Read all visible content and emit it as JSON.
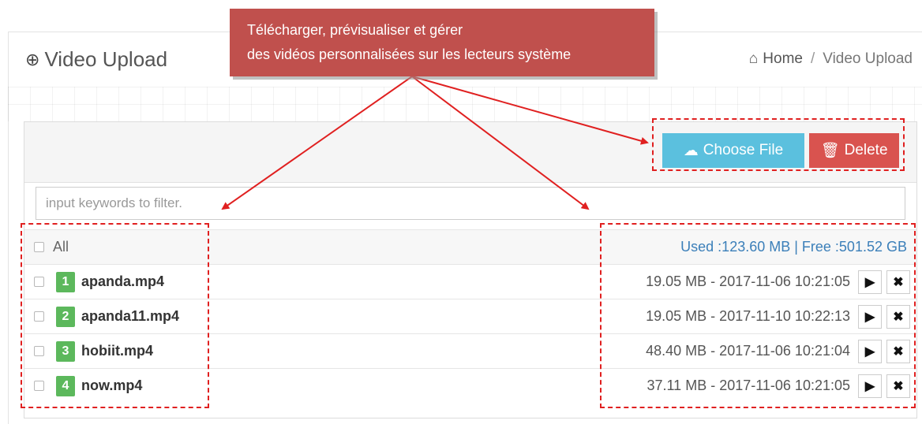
{
  "header": {
    "title": "Video Upload",
    "breadcrumb": {
      "home": "Home",
      "separator": "/",
      "current": "Video Upload"
    }
  },
  "callout": {
    "line1": "Télécharger, prévisualiser et gérer",
    "line2": "des vidéos personnalisées sur les lecteurs système"
  },
  "toolbar": {
    "choose_file_label": "Choose File",
    "delete_label": "Delete"
  },
  "filter": {
    "placeholder": "input keywords to filter.",
    "value": ""
  },
  "list": {
    "all_label": "All",
    "storage": "Used :123.60 MB | Free :501.52 GB",
    "files": [
      {
        "index": "1",
        "name": "apanda.mp4",
        "meta": "19.05 MB - 2017-11-06 10:21:05"
      },
      {
        "index": "2",
        "name": "apanda11.mp4",
        "meta": "19.05 MB - 2017-11-10 10:22:13"
      },
      {
        "index": "3",
        "name": "hobiit.mp4",
        "meta": "48.40 MB - 2017-11-06 10:21:04"
      },
      {
        "index": "4",
        "name": "now.mp4",
        "meta": "37.11 MB - 2017-11-06 10:21:05"
      }
    ]
  },
  "icons": {
    "title": "upload-circle-icon",
    "home": "home-icon",
    "choose_file": "cloud-upload-icon",
    "delete": "trash-icon",
    "play": "play-icon",
    "remove": "close-icon"
  },
  "colors": {
    "choose_button": "#5bc0de",
    "delete_button": "#d9534f",
    "index_badge": "#5cb85c",
    "storage_text": "#3b7fb9",
    "callout_bg": "#c0504d",
    "annotation": "#e02020"
  }
}
